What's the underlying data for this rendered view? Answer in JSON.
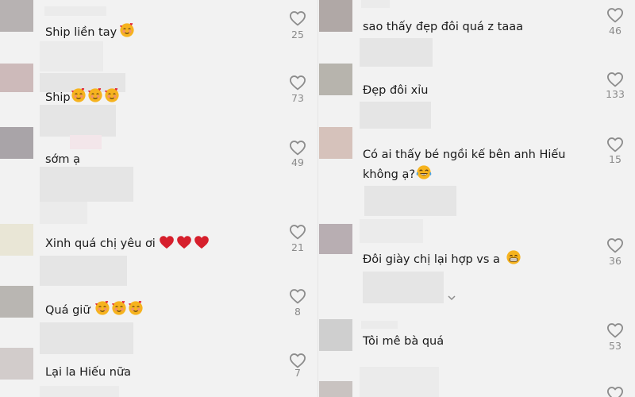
{
  "left_comments": [
    {
      "text": "Ship liền tay",
      "emoji": "🥰",
      "likes": "25"
    },
    {
      "text": "Ship",
      "emoji": "🥰🥰🥰",
      "likes": "73"
    },
    {
      "text": "sớm ạ",
      "emoji": "",
      "likes": "49"
    },
    {
      "text": "Xinh quá chị yêu ơi",
      "emoji": "❤❤❤",
      "likes": "21"
    },
    {
      "text": "Quá giữ",
      "emoji": "🥰🥰🥰",
      "likes": "8"
    },
    {
      "text": "Lại la Hiếu nữa",
      "emoji": "",
      "likes": "7"
    }
  ],
  "right_comments": [
    {
      "text": "sao thấy đẹp đôi quá z taaa",
      "emoji": "",
      "likes": "46"
    },
    {
      "text": "Đẹp đôi xỉu",
      "emoji": "",
      "likes": "133"
    },
    {
      "text": "Có ai thấy bé ngồi kế bên anh Hiếu không ạ?",
      "emoji": "😂",
      "likes": "15"
    },
    {
      "text": "Đôi giày chị lại hợp vs a",
      "emoji": "😁",
      "likes": "36"
    },
    {
      "text": "Tôi mê bà quá",
      "emoji": "",
      "likes": "53"
    }
  ],
  "icons": {
    "like": "heart-outline-icon",
    "more_replies": "chevron-down-icon"
  },
  "colors": {
    "background": "#f2f2f2",
    "count_text": "#8a8a8a",
    "heart_stroke": "#8c8c8c",
    "heart_emoji": "#d61f2c",
    "blush_emoji": "#f6b31e"
  }
}
